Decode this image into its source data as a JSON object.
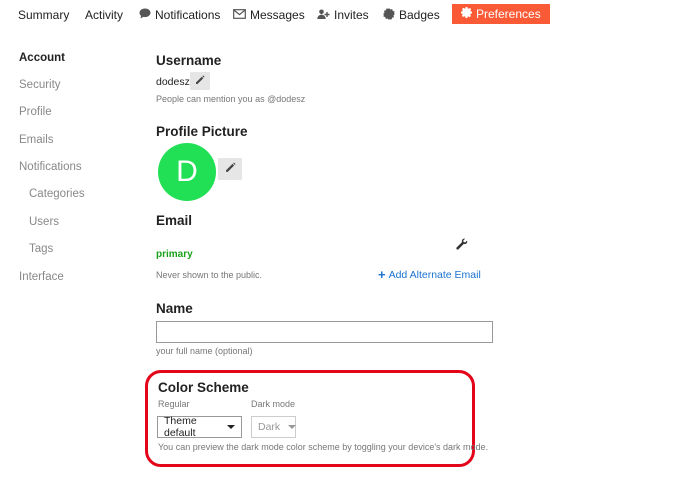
{
  "nav": {
    "summary": "Summary",
    "activity": "Activity",
    "notifications": "Notifications",
    "messages": "Messages",
    "invites": "Invites",
    "badges": "Badges",
    "preferences": "Preferences"
  },
  "sidebar": {
    "account": "Account",
    "security": "Security",
    "profile": "Profile",
    "emails": "Emails",
    "notifications": "Notifications",
    "categories": "Categories",
    "users": "Users",
    "tags": "Tags",
    "interface": "Interface"
  },
  "username": {
    "heading": "Username",
    "value": "dodesz",
    "hint": "People can mention you as @dodesz"
  },
  "profile_picture": {
    "heading": "Profile Picture",
    "initial": "D"
  },
  "email": {
    "heading": "Email",
    "primary_label": "primary",
    "hint": "Never shown to the public.",
    "add_alternate": "Add Alternate Email"
  },
  "name": {
    "heading": "Name",
    "value": "",
    "hint": "your full name (optional)"
  },
  "color_scheme": {
    "heading": "Color Scheme",
    "regular_label": "Regular",
    "dark_label": "Dark mode",
    "regular_value": "Theme default",
    "dark_value": "Dark",
    "hint": "You can preview the dark mode color scheme by toggling your device's dark mode."
  },
  "colors": {
    "accent": "#fa5a35",
    "avatar": "#22e055",
    "primary_green": "#1aa31a",
    "link_blue": "#1a73d1",
    "highlight_red": "#e3061b"
  },
  "icons": {
    "notifications": "speech-bubble-icon",
    "messages": "envelope-icon",
    "invites": "user-plus-icon",
    "badges": "badge-icon",
    "preferences": "gear-icon",
    "edit": "pencil-icon",
    "email_settings": "wrench-icon"
  }
}
